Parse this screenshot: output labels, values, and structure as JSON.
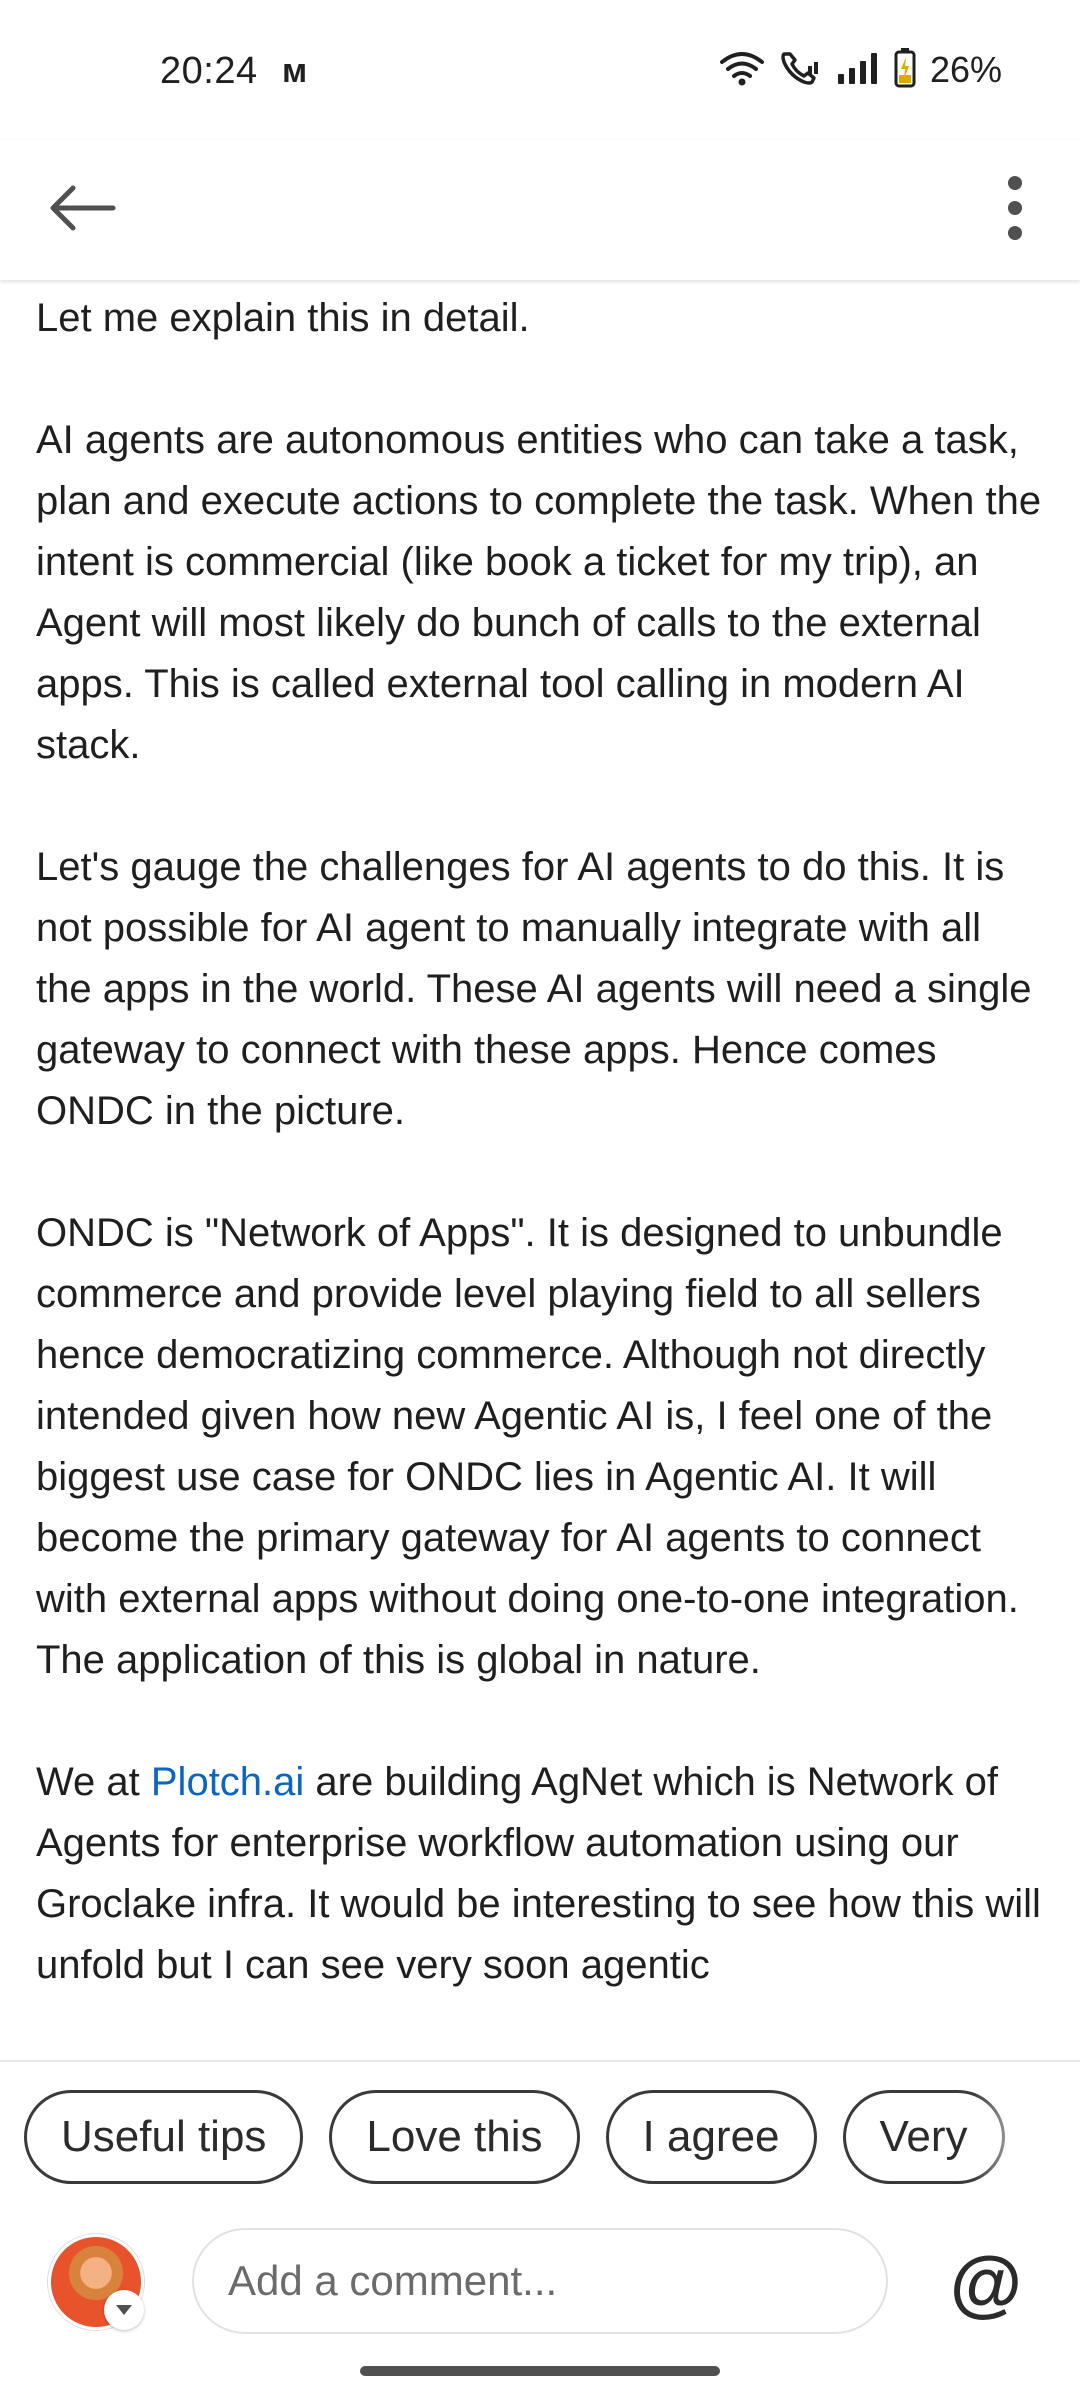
{
  "status_bar": {
    "time": "20:24",
    "notification_glyph": "ᴍ",
    "battery_percent": "26%",
    "icons": [
      "wifi-icon",
      "wifi-calling-icon",
      "signal-icon",
      "battery-charging-icon"
    ]
  },
  "app_bar": {
    "back_icon": "arrow-left-icon",
    "more_icon": "more-vertical-icon"
  },
  "post": {
    "paragraphs": [
      "Let me explain this in detail.",
      "AI agents are autonomous entities who can take a task, plan and execute actions to complete the task. When the intent is commercial (like book a ticket for my trip), an Agent will most likely do bunch of calls to the external apps. This is called external tool calling in modern AI stack.",
      "Let's gauge the challenges for AI agents to do this. It is not possible for AI agent to manually integrate with all the apps in the world. These AI agents will need a single gateway to connect with these apps. Hence comes ONDC in the picture.",
      "ONDC is \"Network of Apps\". It is designed to unbundle commerce and provide level playing field to all sellers hence democratizing commerce. Although not directly intended given how new Agentic AI is, I feel one of the biggest use case for ONDC lies in Agentic AI. It will become the primary gateway for AI agents to connect with external apps without doing one-to-one integration. The application of this is global in nature."
    ],
    "last_paragraph": {
      "before_link": "We at ",
      "link_text": "Plotch.ai",
      "after_link": " are building AgNet which is Network of Agents for enterprise workflow automation using our Groclake infra. It would be interesting to see how this will unfold but I can see very soon agentic"
    },
    "link_color": "#0a66c2"
  },
  "reactions": {
    "chips": [
      "Useful tips",
      "Love this",
      "I agree",
      "Very"
    ]
  },
  "comment_bar": {
    "placeholder": "Add a comment...",
    "mention_symbol": "@"
  }
}
